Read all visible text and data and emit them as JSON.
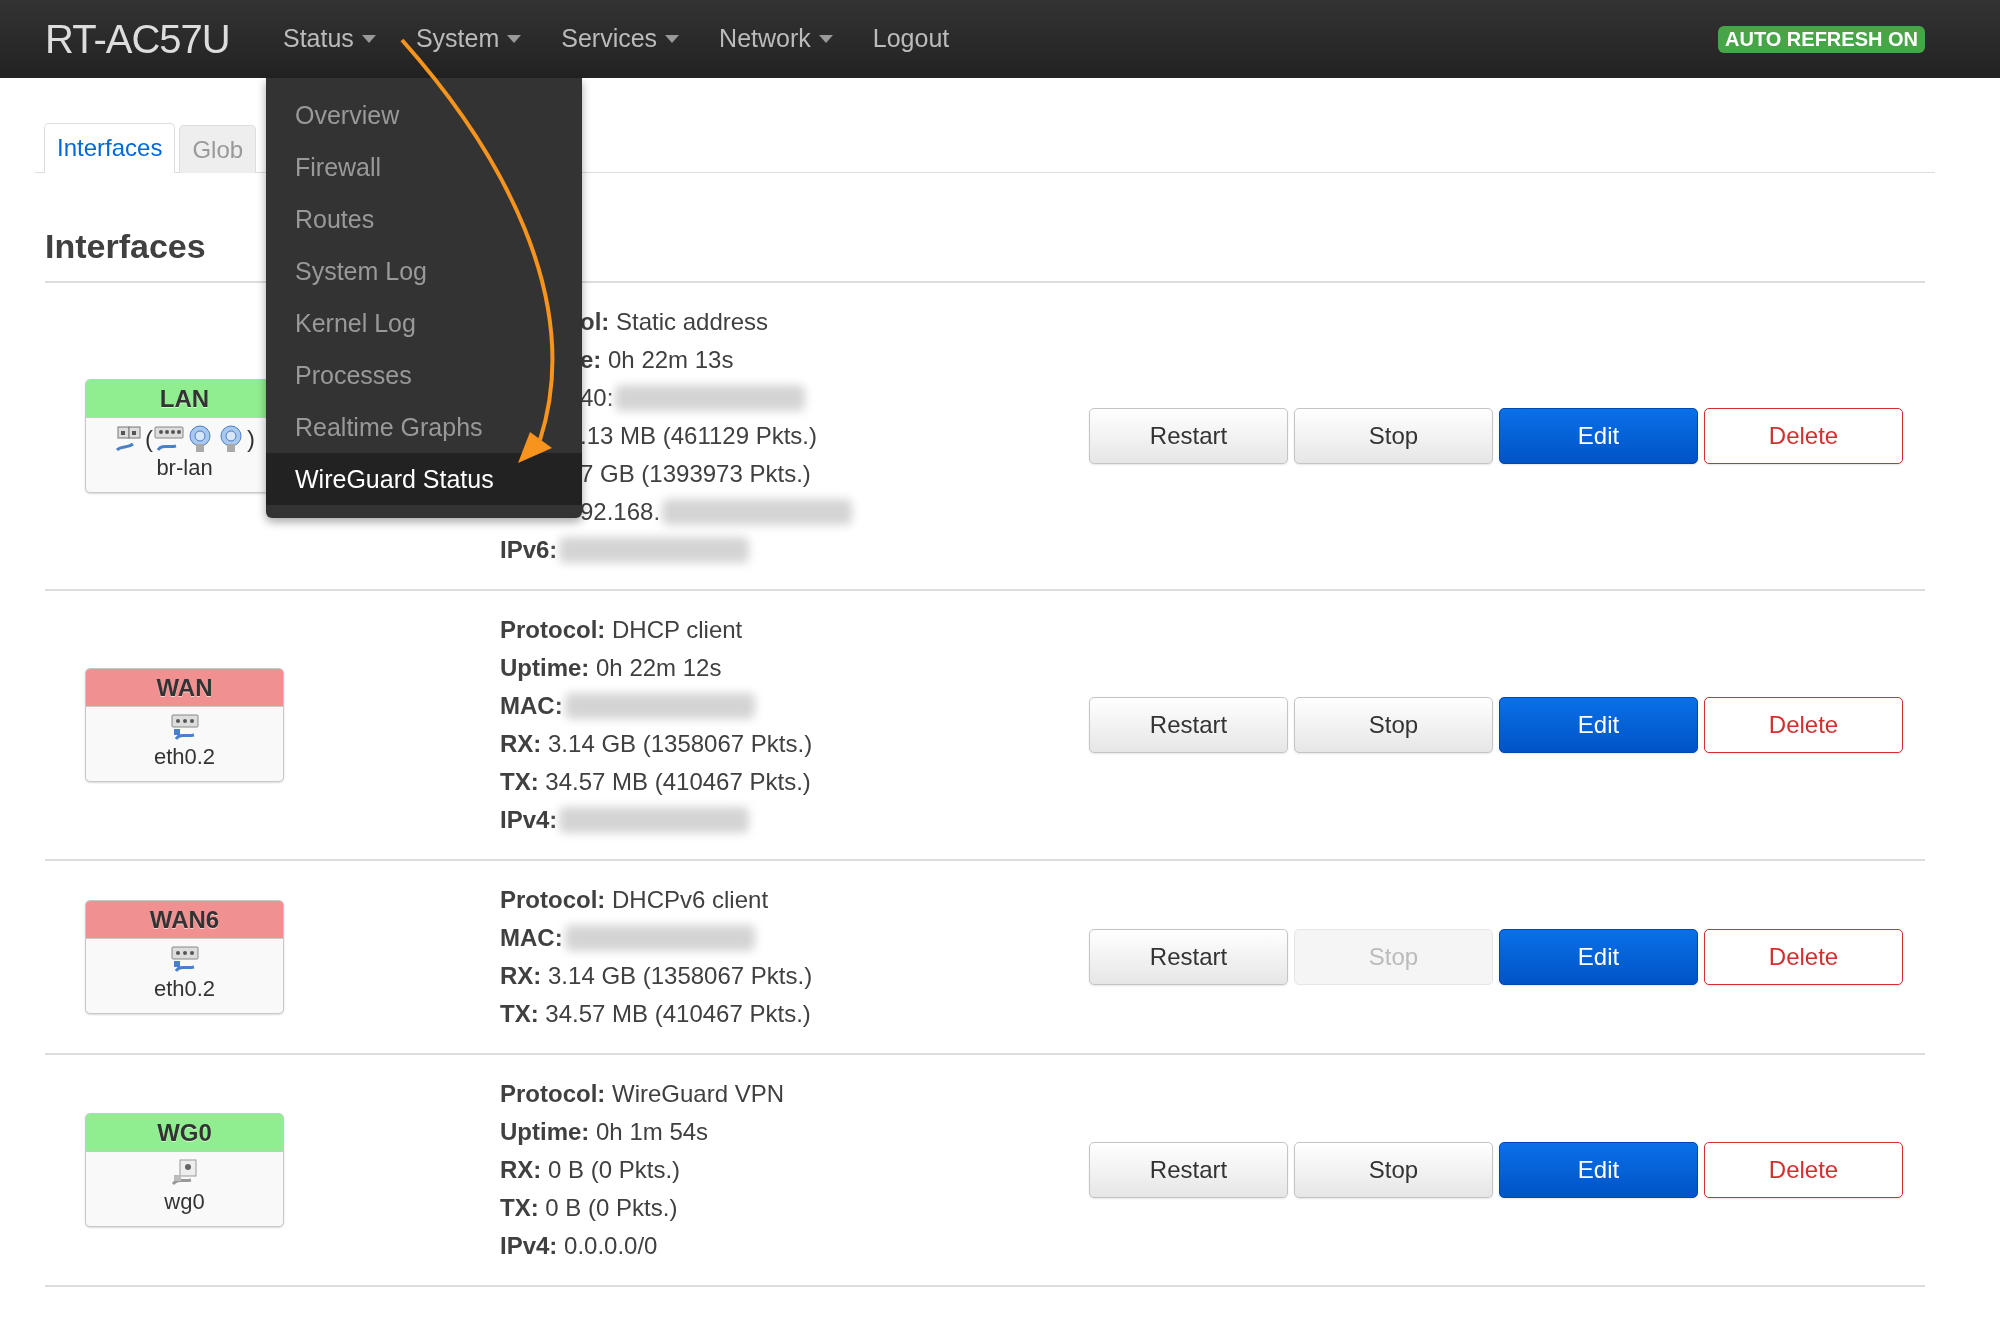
{
  "navbar": {
    "brand": "RT-AC57U",
    "menus": [
      {
        "label": "Status",
        "dropdown": true,
        "items": [
          {
            "label": "Overview",
            "selected": false
          },
          {
            "label": "Firewall",
            "selected": false
          },
          {
            "label": "Routes",
            "selected": false
          },
          {
            "label": "System Log",
            "selected": false
          },
          {
            "label": "Kernel Log",
            "selected": false
          },
          {
            "label": "Processes",
            "selected": false
          },
          {
            "label": "Realtime Graphs",
            "selected": false
          },
          {
            "label": "WireGuard Status",
            "selected": true
          }
        ]
      },
      {
        "label": "System",
        "dropdown": true
      },
      {
        "label": "Services",
        "dropdown": true
      },
      {
        "label": "Network",
        "dropdown": true
      },
      {
        "label": "Logout",
        "dropdown": false
      }
    ],
    "badge": "AUTO REFRESH ON"
  },
  "tabs": [
    {
      "label": "Interfaces",
      "selected": true
    },
    {
      "label": "Glob",
      "selected": false
    }
  ],
  "heading": "Interfaces",
  "interfaces": [
    {
      "name": "LAN",
      "color": "#90ee90",
      "devices": [
        {
          "kind": "bridge"
        },
        {
          "kind": "text",
          "text": "("
        },
        {
          "kind": "switch"
        },
        {
          "kind": "wifi"
        },
        {
          "kind": "wifi"
        },
        {
          "kind": "text",
          "text": ")"
        }
      ],
      "device_name": "br-lan",
      "details": [
        {
          "label": "ol:",
          "value": "Static address",
          "covered": true
        },
        {
          "label": "e:",
          "value": "0h 22m 13s",
          "covered": true
        },
        {
          "value": "40:",
          "redacted": true,
          "covered": true
        },
        {
          "value": ".13 MB (461129 Pkts.)",
          "covered": true
        },
        {
          "value": "7 GB (1393973 Pkts.)",
          "covered": true
        },
        {
          "value": "92.168.",
          "redacted": true,
          "covered": true
        },
        {
          "label": "IPv6:",
          "redacted": true
        }
      ],
      "buttons": [
        {
          "label": "Restart",
          "kind": "default",
          "disabled": false
        },
        {
          "label": "Stop",
          "kind": "default",
          "disabled": false
        },
        {
          "label": "Edit",
          "kind": "primary",
          "disabled": false
        },
        {
          "label": "Delete",
          "kind": "danger",
          "disabled": false
        }
      ]
    },
    {
      "name": "WAN",
      "color": "#f09090",
      "devices": [
        {
          "kind": "ethernet"
        }
      ],
      "device_name": "eth0.2",
      "details": [
        {
          "label": "Protocol:",
          "value": "DHCP client"
        },
        {
          "label": "Uptime:",
          "value": "0h 22m 12s"
        },
        {
          "label": "MAC:",
          "redacted": true
        },
        {
          "label": "RX:",
          "value": "3.14 GB (1358067 Pkts.)"
        },
        {
          "label": "TX:",
          "value": "34.57 MB (410467 Pkts.)"
        },
        {
          "label": "IPv4:",
          "redacted": true
        }
      ],
      "buttons": [
        {
          "label": "Restart",
          "kind": "default",
          "disabled": false
        },
        {
          "label": "Stop",
          "kind": "default",
          "disabled": false
        },
        {
          "label": "Edit",
          "kind": "primary",
          "disabled": false
        },
        {
          "label": "Delete",
          "kind": "danger",
          "disabled": false
        }
      ]
    },
    {
      "name": "WAN6",
      "color": "#f09090",
      "devices": [
        {
          "kind": "ethernet"
        }
      ],
      "device_name": "eth0.2",
      "details": [
        {
          "label": "Protocol:",
          "value": "DHCPv6 client"
        },
        {
          "label": "MAC:",
          "redacted": true
        },
        {
          "label": "RX:",
          "value": "3.14 GB (1358067 Pkts.)"
        },
        {
          "label": "TX:",
          "value": "34.57 MB (410467 Pkts.)"
        }
      ],
      "buttons": [
        {
          "label": "Restart",
          "kind": "default",
          "disabled": false
        },
        {
          "label": "Stop",
          "kind": "default",
          "disabled": true
        },
        {
          "label": "Edit",
          "kind": "primary",
          "disabled": false
        },
        {
          "label": "Delete",
          "kind": "danger",
          "disabled": false
        }
      ]
    },
    {
      "name": "WG0",
      "color": "#90ee90",
      "devices": [
        {
          "kind": "tunnel"
        }
      ],
      "device_name": "wg0",
      "details": [
        {
          "label": "Protocol:",
          "value": "WireGuard VPN"
        },
        {
          "label": "Uptime:",
          "value": "0h 1m 54s"
        },
        {
          "label": "RX:",
          "value": "0 B (0 Pkts.)"
        },
        {
          "label": "TX:",
          "value": "0 B (0 Pkts.)"
        },
        {
          "label": "IPv4:",
          "value": "0.0.0.0/0"
        }
      ],
      "buttons": [
        {
          "label": "Restart",
          "kind": "default",
          "disabled": false
        },
        {
          "label": "Stop",
          "kind": "default",
          "disabled": false
        },
        {
          "label": "Edit",
          "kind": "primary",
          "disabled": false
        },
        {
          "label": "Delete",
          "kind": "danger",
          "disabled": false
        }
      ]
    }
  ]
}
